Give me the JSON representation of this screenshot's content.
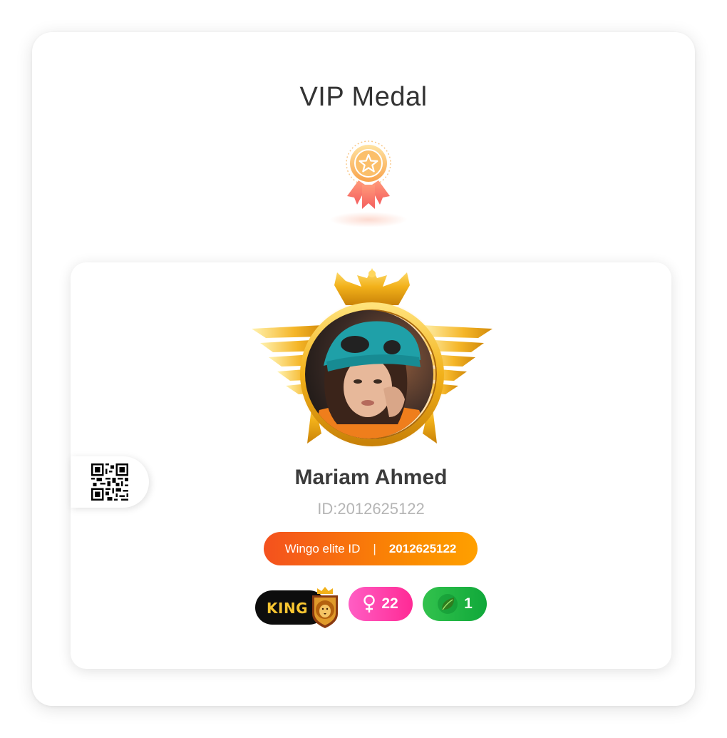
{
  "page": {
    "title": "VIP Medal"
  },
  "profile": {
    "name": "Mariam Ahmed",
    "id_text": "ID:2012625122",
    "elite": {
      "label": "Wingo elite ID",
      "separator": "|",
      "value": "2012625122"
    },
    "badges": {
      "king_label": "KING",
      "gender_count": "22",
      "leaf_count": "1"
    }
  },
  "icons": {
    "medal": "medal-ribbon-icon",
    "qr": "qr-code-icon",
    "frame": "winged-crown-frame",
    "lion": "lion-crest-icon",
    "gender": "female-icon",
    "leaf": "leaf-icon"
  },
  "colors": {
    "elite_gradient_start": "#f4511e",
    "elite_gradient_end": "#ffa000",
    "gender_badge": "#ff2a95",
    "leaf_badge": "#10a83a",
    "king_text": "#f7c531",
    "gold": "#f2b11a"
  }
}
